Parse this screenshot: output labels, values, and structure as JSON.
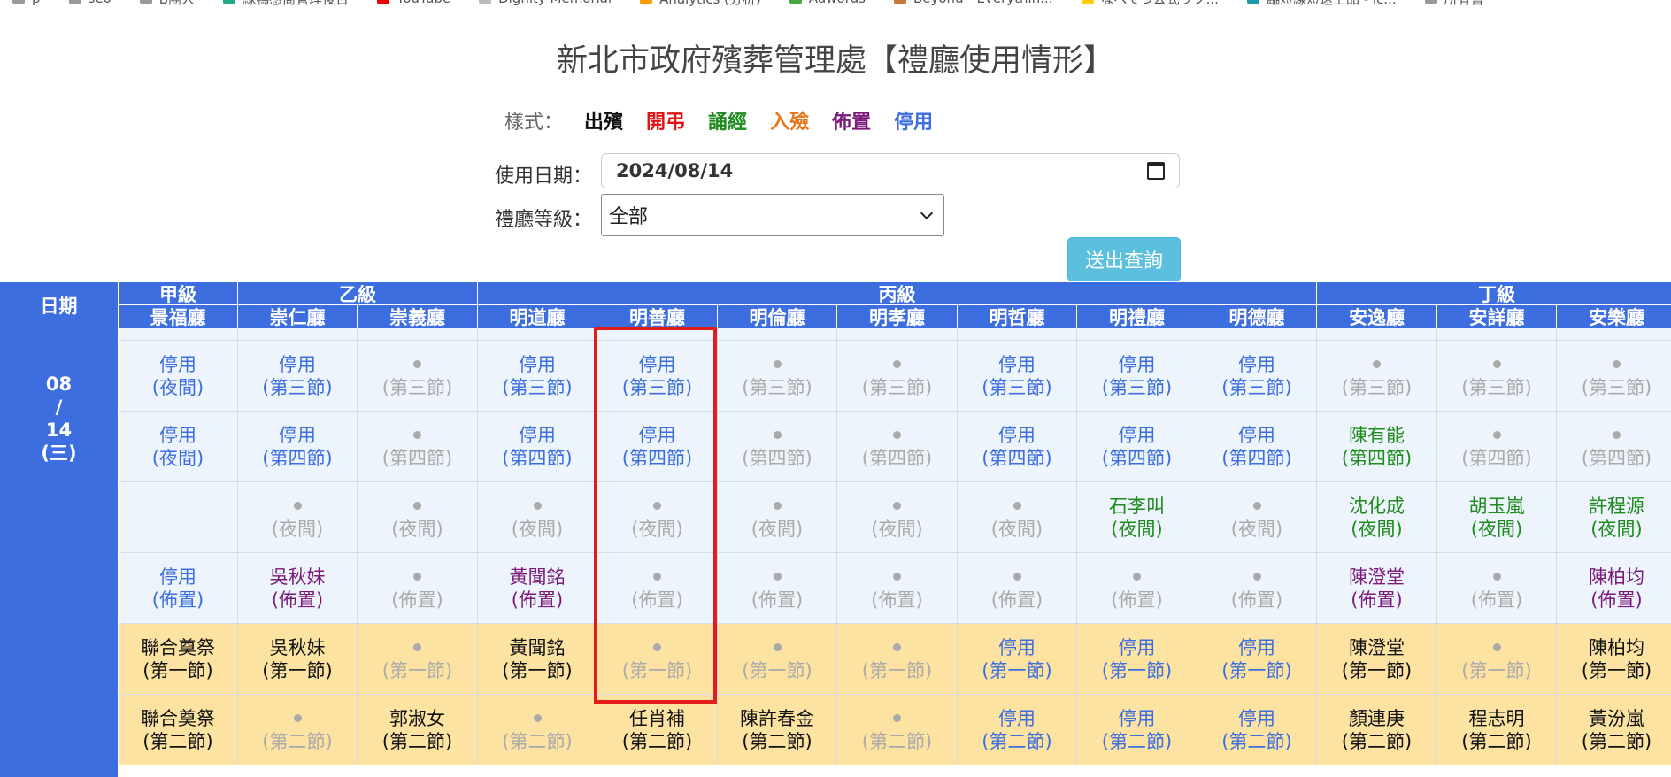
{
  "bookmarks": [
    {
      "label": "p",
      "color": "#999"
    },
    {
      "label": "seo",
      "color": "#999"
    },
    {
      "label": "B團人",
      "color": "#999"
    },
    {
      "label": "綠鴨感商管理後台",
      "color": "#2a8"
    },
    {
      "label": "YouTube",
      "color": "#e00"
    },
    {
      "label": "Dignity Memorial",
      "color": "#bbb"
    },
    {
      "label": "Analytics (分析)",
      "color": "#f90"
    },
    {
      "label": "Adwords",
      "color": "#4a4"
    },
    {
      "label": "Beyond - Everythin...",
      "color": "#c73"
    },
    {
      "label": "なべてつ公式ラブ...",
      "color": "#fc0"
    },
    {
      "label": "臨短線短速上品 - ic...",
      "color": "#29a"
    },
    {
      "label": "所有書",
      "color": "#999"
    }
  ],
  "title": "新北市政府殯葬管理處【禮廳使用情形】",
  "legend": {
    "label": "樣式：",
    "items": [
      {
        "text": "出殯",
        "color": "#111111"
      },
      {
        "text": "開弔",
        "color": "#e11111"
      },
      {
        "text": "誦經",
        "color": "#1f8b1f"
      },
      {
        "text": "入殮",
        "color": "#e8751a"
      },
      {
        "text": "佈置",
        "color": "#7a1a7a"
      },
      {
        "text": "停用",
        "color": "#3d6ee0"
      }
    ]
  },
  "form": {
    "date_label": "使用日期：",
    "date_value": "2024/08/14",
    "level_label": "禮廳等級：",
    "level_value": "全部",
    "submit": "送出查詢"
  },
  "table": {
    "date_header": "日期",
    "levels": [
      {
        "name": "甲級",
        "span": 1
      },
      {
        "name": "乙級",
        "span": 2
      },
      {
        "name": "丙級",
        "span": 7
      },
      {
        "name": "丁級",
        "span": 3
      }
    ],
    "halls": [
      "景福廳",
      "崇仁廳",
      "崇義廳",
      "明道廳",
      "明善廳",
      "明倫廳",
      "明孝廳",
      "明哲廳",
      "明禮廳",
      "明德廳",
      "安逸廳",
      "安詳廳",
      "安樂廳"
    ],
    "date_cell": {
      "month": "08",
      "sep": "/",
      "day": "14",
      "weekday": "(三)"
    },
    "rows_blue": [
      [
        {
          "name": "停用",
          "slot": "(夜間)",
          "status": "stop"
        },
        {
          "name": "停用",
          "slot": "(第三節)",
          "status": "stop"
        },
        {
          "name": "",
          "slot": "(第三節)",
          "status": "blank"
        },
        {
          "name": "停用",
          "slot": "(第三節)",
          "status": "stop"
        },
        {
          "name": "停用",
          "slot": "(第三節)",
          "status": "stop"
        },
        {
          "name": "",
          "slot": "(第三節)",
          "status": "blank"
        },
        {
          "name": "",
          "slot": "(第三節)",
          "status": "blank"
        },
        {
          "name": "停用",
          "slot": "(第三節)",
          "status": "stop"
        },
        {
          "name": "停用",
          "slot": "(第三節)",
          "status": "stop"
        },
        {
          "name": "停用",
          "slot": "(第三節)",
          "status": "stop"
        },
        {
          "name": "",
          "slot": "(第三節)",
          "status": "blank"
        },
        {
          "name": "",
          "slot": "(第三節)",
          "status": "blank"
        },
        {
          "name": "",
          "slot": "(第三節)",
          "status": "blank"
        }
      ],
      [
        {
          "name": "停用",
          "slot": "(夜間)",
          "status": "stop"
        },
        {
          "name": "停用",
          "slot": "(第四節)",
          "status": "stop"
        },
        {
          "name": "",
          "slot": "(第四節)",
          "status": "blank"
        },
        {
          "name": "停用",
          "slot": "(第四節)",
          "status": "stop"
        },
        {
          "name": "停用",
          "slot": "(第四節)",
          "status": "stop"
        },
        {
          "name": "",
          "slot": "(第四節)",
          "status": "blank"
        },
        {
          "name": "",
          "slot": "(第四節)",
          "status": "blank"
        },
        {
          "name": "停用",
          "slot": "(第四節)",
          "status": "stop"
        },
        {
          "name": "停用",
          "slot": "(第四節)",
          "status": "stop"
        },
        {
          "name": "停用",
          "slot": "(第四節)",
          "status": "stop"
        },
        {
          "name": "陳有能",
          "slot": "(第四節)",
          "status": "green"
        },
        {
          "name": "",
          "slot": "(第四節)",
          "status": "blank"
        },
        {
          "name": "",
          "slot": "(第四節)",
          "status": "blank"
        }
      ],
      [
        {
          "name": "",
          "slot": "",
          "status": "empty"
        },
        {
          "name": "",
          "slot": "(夜間)",
          "status": "blank"
        },
        {
          "name": "",
          "slot": "(夜間)",
          "status": "blank"
        },
        {
          "name": "",
          "slot": "(夜間)",
          "status": "blank"
        },
        {
          "name": "",
          "slot": "(夜間)",
          "status": "blank"
        },
        {
          "name": "",
          "slot": "(夜間)",
          "status": "blank"
        },
        {
          "name": "",
          "slot": "(夜間)",
          "status": "blank"
        },
        {
          "name": "",
          "slot": "(夜間)",
          "status": "blank"
        },
        {
          "name": "石李叫",
          "slot": "(夜間)",
          "status": "green"
        },
        {
          "name": "",
          "slot": "(夜間)",
          "status": "blank"
        },
        {
          "name": "沈化成",
          "slot": "(夜間)",
          "status": "green"
        },
        {
          "name": "胡玉嵐",
          "slot": "(夜間)",
          "status": "green"
        },
        {
          "name": "許程源",
          "slot": "(夜間)",
          "status": "green"
        }
      ],
      [
        {
          "name": "停用",
          "slot": "(佈置)",
          "status": "stop"
        },
        {
          "name": "吳秋妹",
          "slot": "(佈置)",
          "status": "purple"
        },
        {
          "name": "",
          "slot": "(佈置)",
          "status": "blank"
        },
        {
          "name": "黃聞銘",
          "slot": "(佈置)",
          "status": "purple"
        },
        {
          "name": "",
          "slot": "(佈置)",
          "status": "blank"
        },
        {
          "name": "",
          "slot": "(佈置)",
          "status": "blank"
        },
        {
          "name": "",
          "slot": "(佈置)",
          "status": "blank"
        },
        {
          "name": "",
          "slot": "(佈置)",
          "status": "blank"
        },
        {
          "name": "",
          "slot": "(佈置)",
          "status": "blank"
        },
        {
          "name": "",
          "slot": "(佈置)",
          "status": "blank"
        },
        {
          "name": "陳澄堂",
          "slot": "(佈置)",
          "status": "purple"
        },
        {
          "name": "",
          "slot": "(佈置)",
          "status": "blank"
        },
        {
          "name": "陳柏均",
          "slot": "(佈置)",
          "status": "purple"
        }
      ]
    ],
    "rows_yellow": [
      [
        {
          "name": "聯合奠祭",
          "slot": "(第一節)",
          "status": "black"
        },
        {
          "name": "吳秋妹",
          "slot": "(第一節)",
          "status": "black"
        },
        {
          "name": "",
          "slot": "(第一節)",
          "status": "blank"
        },
        {
          "name": "黃聞銘",
          "slot": "(第一節)",
          "status": "black"
        },
        {
          "name": "",
          "slot": "(第一節)",
          "status": "blank"
        },
        {
          "name": "",
          "slot": "(第一節)",
          "status": "blank"
        },
        {
          "name": "",
          "slot": "(第一節)",
          "status": "blank"
        },
        {
          "name": "停用",
          "slot": "(第一節)",
          "status": "stop"
        },
        {
          "name": "停用",
          "slot": "(第一節)",
          "status": "stop"
        },
        {
          "name": "停用",
          "slot": "(第一節)",
          "status": "stop"
        },
        {
          "name": "陳澄堂",
          "slot": "(第一節)",
          "status": "black"
        },
        {
          "name": "",
          "slot": "(第一節)",
          "status": "blank"
        },
        {
          "name": "陳柏均",
          "slot": "(第一節)",
          "status": "black"
        }
      ],
      [
        {
          "name": "聯合奠祭",
          "slot": "(第二節)",
          "status": "black"
        },
        {
          "name": "",
          "slot": "(第二節)",
          "status": "blank"
        },
        {
          "name": "郭淑女",
          "slot": "(第二節)",
          "status": "black"
        },
        {
          "name": "",
          "slot": "(第二節)",
          "status": "blank"
        },
        {
          "name": "任肖補",
          "slot": "(第二節)",
          "status": "black"
        },
        {
          "name": "陳許春金",
          "slot": "(第二節)",
          "status": "black"
        },
        {
          "name": "",
          "slot": "(第二節)",
          "status": "blank"
        },
        {
          "name": "停用",
          "slot": "(第二節)",
          "status": "stop"
        },
        {
          "name": "停用",
          "slot": "(第二節)",
          "status": "stop"
        },
        {
          "name": "停用",
          "slot": "(第二節)",
          "status": "stop"
        },
        {
          "name": "顏連庚",
          "slot": "(第二節)",
          "status": "black"
        },
        {
          "name": "程志明",
          "slot": "(第二節)",
          "status": "black"
        },
        {
          "name": "黃汾嵐",
          "slot": "(第二節)",
          "status": "black"
        }
      ]
    ]
  }
}
